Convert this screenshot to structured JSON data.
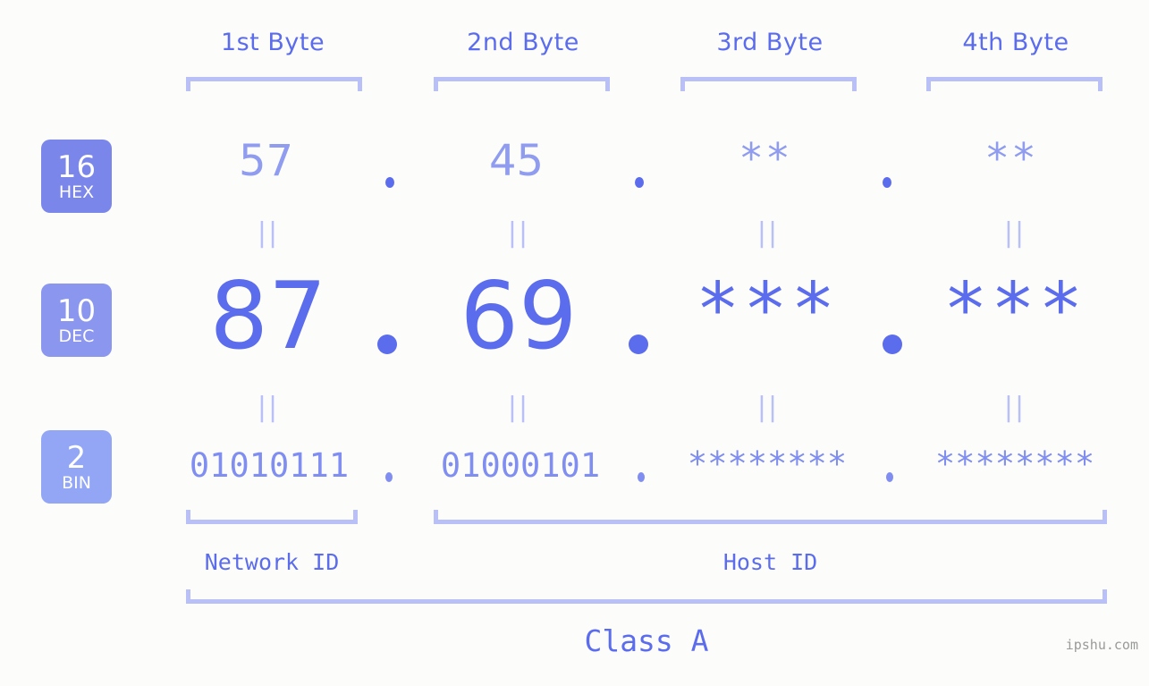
{
  "page": {
    "background_color": "#fcfdfa",
    "accent_color": "#5b6ced",
    "light_accent_color": "#b8c0f7",
    "watermark": "ipshu.com"
  },
  "byte_headers": [
    {
      "label": "1st Byte"
    },
    {
      "label": "2nd Byte"
    },
    {
      "label": "3rd Byte"
    },
    {
      "label": "4th Byte"
    }
  ],
  "bases": [
    {
      "number": "16",
      "name": "HEX",
      "color": "#7b86ea"
    },
    {
      "number": "10",
      "name": "DEC",
      "color": "#8b96ee"
    },
    {
      "number": "2",
      "name": "BIN",
      "color": "#93a6f5"
    }
  ],
  "rows": {
    "hex": {
      "base_number": "16",
      "base_name": "HEX",
      "values": [
        "57",
        "45",
        "**",
        "**"
      ],
      "separator": "."
    },
    "dec": {
      "base_number": "10",
      "base_name": "DEC",
      "values": [
        "87",
        "69",
        "***",
        "***"
      ],
      "separator": "."
    },
    "bin": {
      "base_number": "2",
      "base_name": "BIN",
      "values": [
        "01010111",
        "01000101",
        "********",
        "********"
      ],
      "separator": "."
    }
  },
  "equality_marks": {
    "symbol": "||",
    "count_per_row": 4
  },
  "sections": {
    "network_id": "Network ID",
    "host_id": "Host ID",
    "class": "Class A"
  }
}
